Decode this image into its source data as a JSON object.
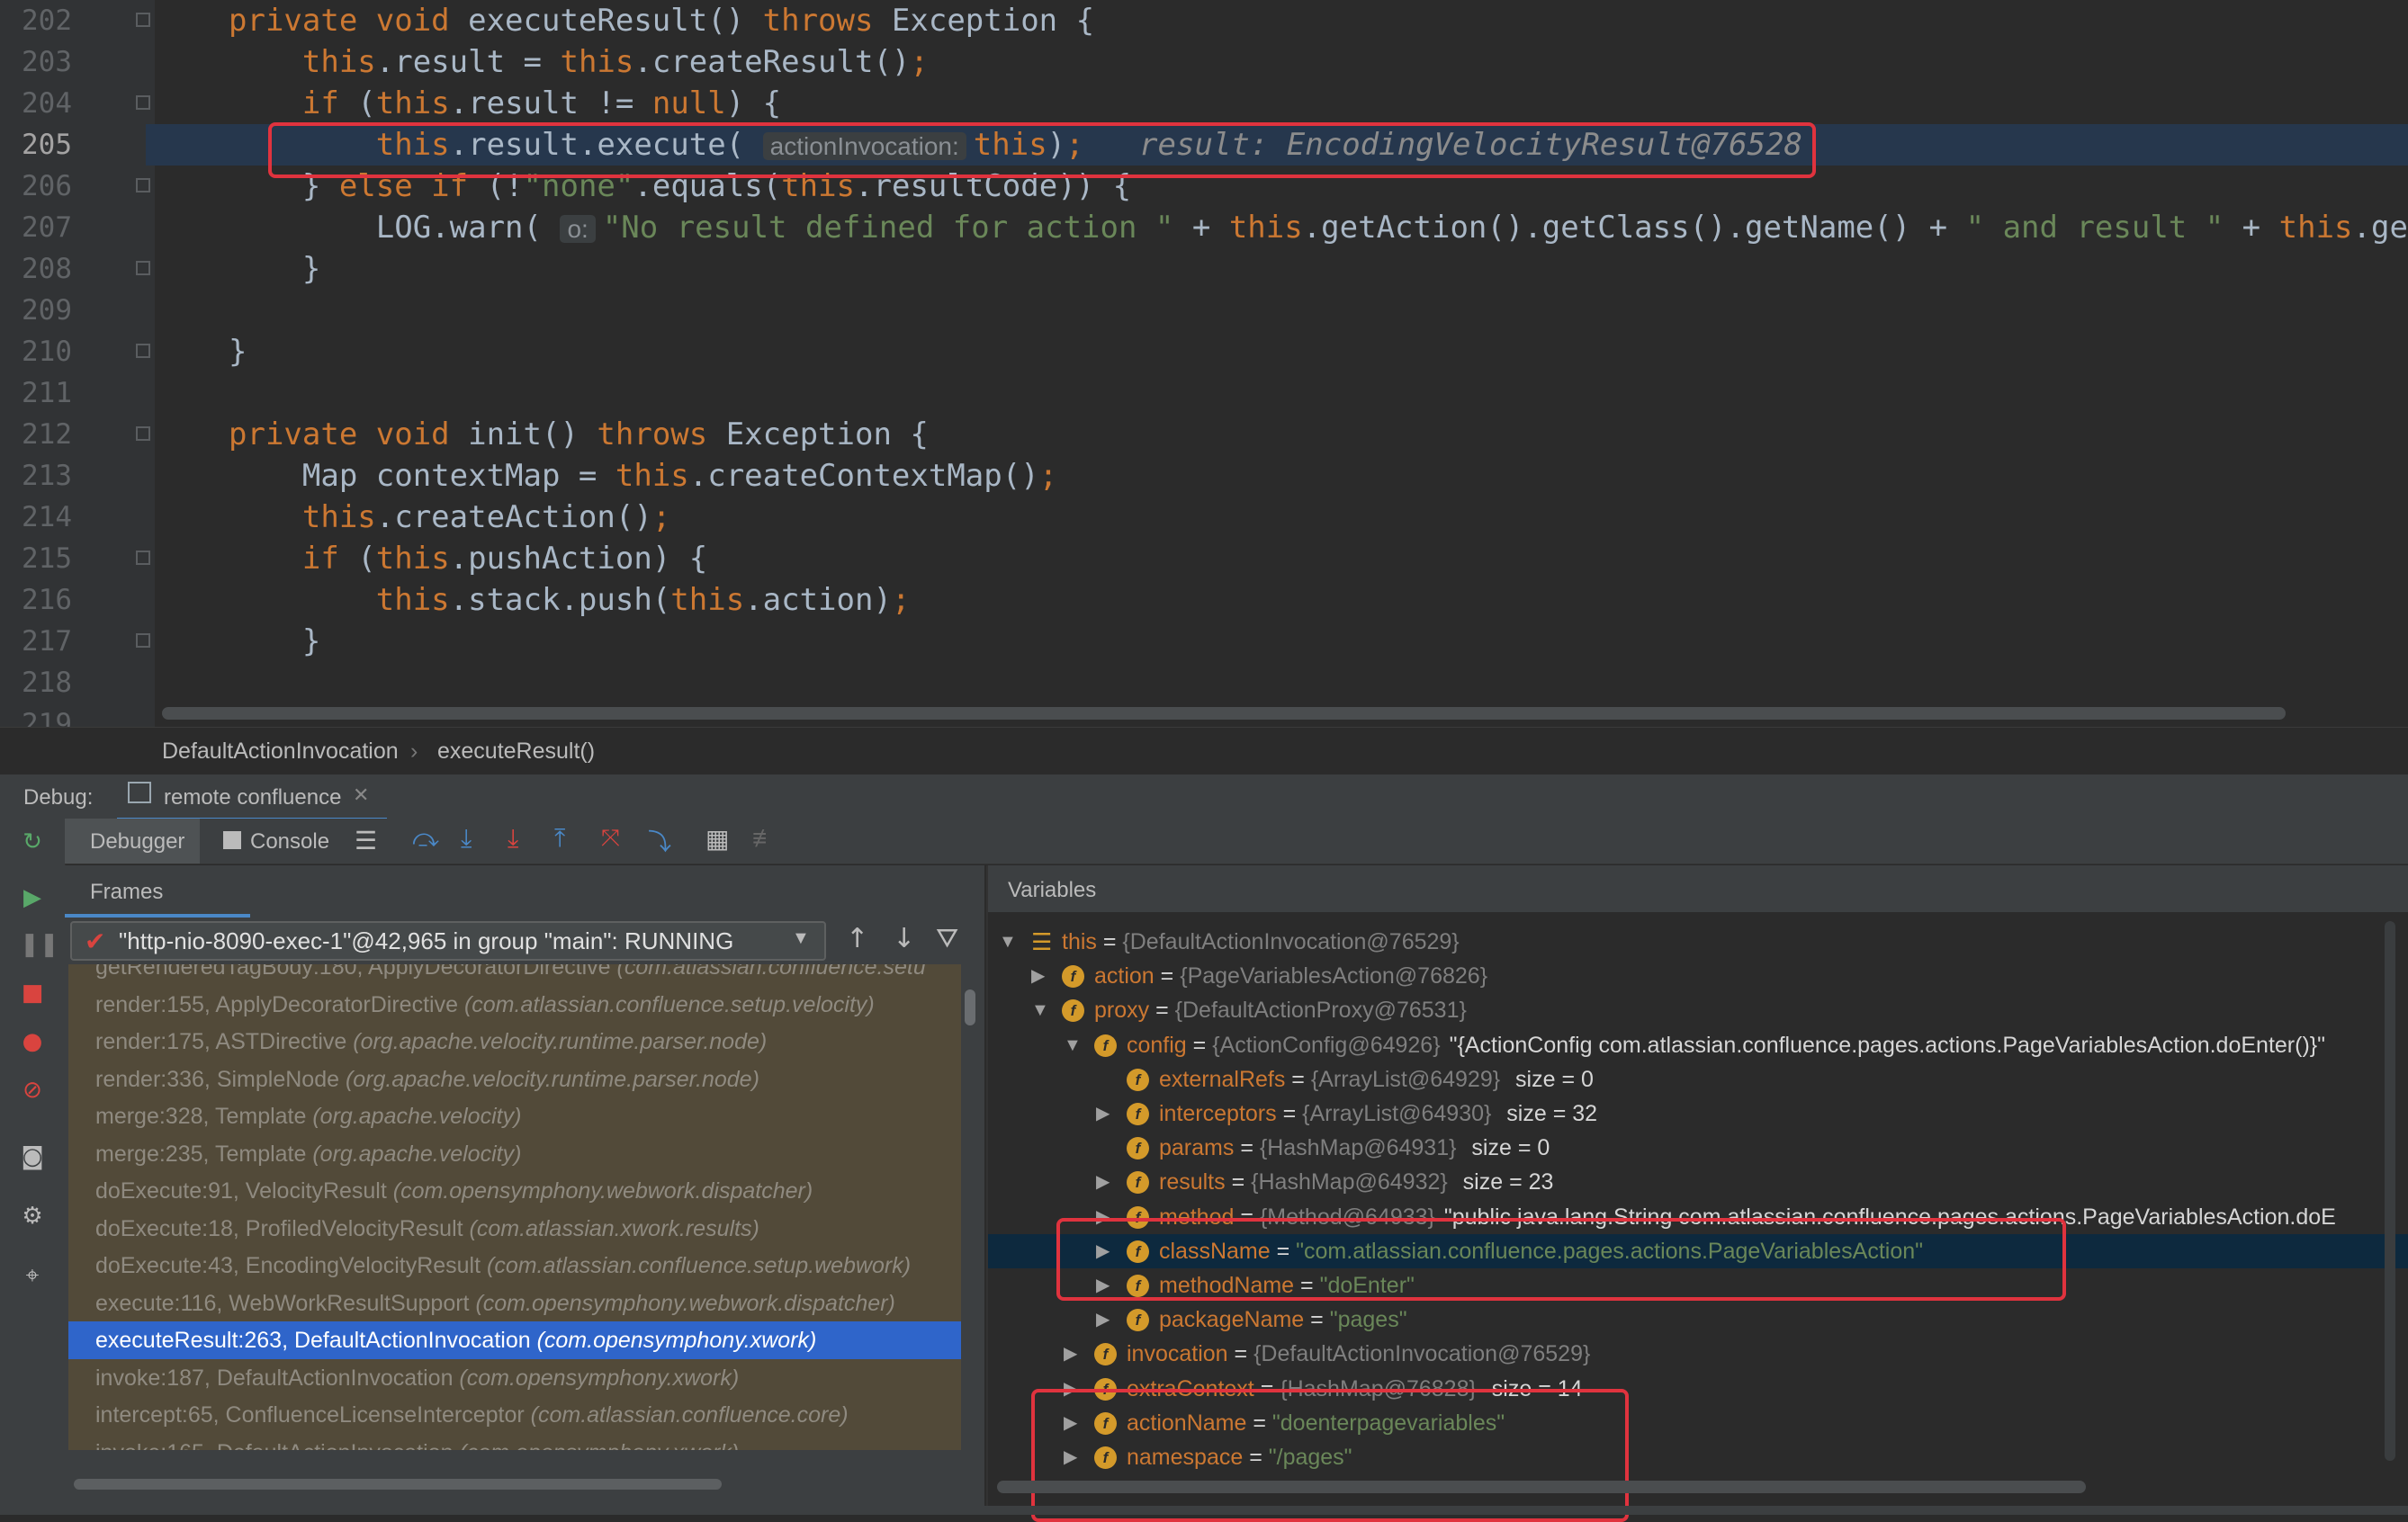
{
  "editor": {
    "lines": [
      {
        "num": "202",
        "tokens": [
          [
            "kw",
            "private void "
          ],
          [
            "",
            "executeResult() "
          ],
          [
            "kw",
            "throws "
          ],
          [
            "",
            "Exception {"
          ]
        ]
      },
      {
        "num": "203",
        "tokens": [
          [
            "kw",
            "    this"
          ],
          [
            "",
            ".result = "
          ],
          [
            "kw",
            "this"
          ],
          [
            "",
            ".createResult()"
          ],
          [
            "kw",
            ";"
          ]
        ]
      },
      {
        "num": "204",
        "tokens": [
          [
            "kw",
            "    if "
          ],
          [
            "",
            "("
          ],
          [
            "kw",
            "this"
          ],
          [
            "",
            ".result != "
          ],
          [
            "kw",
            "null"
          ],
          [
            "",
            ") {"
          ]
        ]
      },
      {
        "num": "205",
        "current": true,
        "tokens": [
          [
            "kw",
            "        this"
          ],
          [
            "",
            ".result.execute( "
          ],
          [
            "hint",
            "actionInvocation:"
          ],
          [
            "kw",
            "this"
          ],
          [
            "",
            ")"
          ],
          [
            "kw",
            ";   "
          ],
          [
            "val",
            "result: EncodingVelocityResult@76528"
          ]
        ]
      },
      {
        "num": "206",
        "tokens": [
          [
            "",
            "    } "
          ],
          [
            "kw",
            "else if "
          ],
          [
            "",
            "(!"
          ],
          [
            "str",
            "\"none\""
          ],
          [
            "",
            ".equals("
          ],
          [
            "kw",
            "this"
          ],
          [
            "",
            ".resultCode)) {"
          ]
        ]
      },
      {
        "num": "207",
        "tokens": [
          [
            "",
            "        LOG.warn( "
          ],
          [
            "hint",
            "o:"
          ],
          [
            "str",
            "\"No result defined for action \""
          ],
          [
            "",
            " + "
          ],
          [
            "kw",
            "this"
          ],
          [
            "",
            ".getAction().getClass().getName() + "
          ],
          [
            "str",
            "\" and result \""
          ],
          [
            "",
            " + "
          ],
          [
            "kw",
            "this"
          ],
          [
            "",
            ".getRes"
          ]
        ]
      },
      {
        "num": "208",
        "tokens": [
          [
            "",
            "    }"
          ]
        ]
      },
      {
        "num": "209",
        "tokens": []
      },
      {
        "num": "210",
        "tokens": [
          [
            "",
            "}"
          ]
        ]
      },
      {
        "num": "211",
        "tokens": []
      },
      {
        "num": "212",
        "tokens": [
          [
            "kw",
            "private void "
          ],
          [
            "",
            "init() "
          ],
          [
            "kw",
            "throws "
          ],
          [
            "",
            "Exception {"
          ]
        ]
      },
      {
        "num": "213",
        "tokens": [
          [
            "",
            "    Map contextMap = "
          ],
          [
            "kw",
            "this"
          ],
          [
            "",
            ".createContextMap()"
          ],
          [
            "kw",
            ";"
          ]
        ]
      },
      {
        "num": "214",
        "tokens": [
          [
            "kw",
            "    this"
          ],
          [
            "",
            ".createAction()"
          ],
          [
            "kw",
            ";"
          ]
        ]
      },
      {
        "num": "215",
        "tokens": [
          [
            "kw",
            "    if "
          ],
          [
            "",
            "("
          ],
          [
            "kw",
            "this"
          ],
          [
            "",
            ".pushAction) {"
          ]
        ]
      },
      {
        "num": "216",
        "tokens": [
          [
            "kw",
            "        this"
          ],
          [
            "",
            ".stack.push("
          ],
          [
            "kw",
            "this"
          ],
          [
            "",
            ".action)"
          ],
          [
            "kw",
            ";"
          ]
        ]
      },
      {
        "num": "217",
        "tokens": [
          [
            "",
            "    }"
          ]
        ]
      },
      {
        "num": "218",
        "tokens": []
      },
      {
        "num": "219",
        "tokens": []
      }
    ]
  },
  "breadcrumb": {
    "class": "DefaultActionInvocation",
    "separator": "›",
    "method": "executeResult()"
  },
  "debug": {
    "label": "Debug:",
    "session": "remote confluence",
    "tabs": {
      "debugger": "Debugger",
      "console": "Console"
    },
    "frames_tab": "Frames",
    "variables_tab": "Variables",
    "thread": "\"http-nio-8090-exec-1\"@42,965 in group \"main\": RUNNING"
  },
  "frames": [
    {
      "loc": "getRenderedTagBody:180, ApplyDecoratorDirective ",
      "pkg": "(com.atlassian.confluence.setu"
    },
    {
      "loc": "render:155, ApplyDecoratorDirective ",
      "pkg": "(com.atlassian.confluence.setup.velocity)"
    },
    {
      "loc": "render:175, ASTDirective ",
      "pkg": "(org.apache.velocity.runtime.parser.node)"
    },
    {
      "loc": "render:336, SimpleNode ",
      "pkg": "(org.apache.velocity.runtime.parser.node)"
    },
    {
      "loc": "merge:328, Template ",
      "pkg": "(org.apache.velocity)"
    },
    {
      "loc": "merge:235, Template ",
      "pkg": "(org.apache.velocity)"
    },
    {
      "loc": "doExecute:91, VelocityResult ",
      "pkg": "(com.opensymphony.webwork.dispatcher)"
    },
    {
      "loc": "doExecute:18, ProfiledVelocityResult ",
      "pkg": "(com.atlassian.xwork.results)"
    },
    {
      "loc": "doExecute:43, EncodingVelocityResult ",
      "pkg": "(com.atlassian.confluence.setup.webwork)"
    },
    {
      "loc": "execute:116, WebWorkResultSupport ",
      "pkg": "(com.opensymphony.webwork.dispatcher)"
    },
    {
      "loc": "executeResult:263, DefaultActionInvocation ",
      "pkg": "(com.opensymphony.xwork)",
      "selected": true
    },
    {
      "loc": "invoke:187, DefaultActionInvocation ",
      "pkg": "(com.opensymphony.xwork)"
    },
    {
      "loc": "intercept:65, ConfluenceLicenseInterceptor ",
      "pkg": "(com.atlassian.confluence.core)"
    },
    {
      "loc": "invoke:165, DefaultActionInvocation ",
      "pkg": "(com.opensymphony.xwork)"
    }
  ],
  "variables": [
    {
      "depth": 0,
      "tri": "down",
      "icon": "list",
      "name": "this",
      "type": "{DefaultActionInvocation@76529}",
      "extra": ""
    },
    {
      "depth": 1,
      "tri": "right",
      "icon": "f",
      "name": "action",
      "type": "{PageVariablesAction@76826}",
      "extra": ""
    },
    {
      "depth": 1,
      "tri": "down",
      "icon": "f",
      "name": "proxy",
      "type": "{DefaultActionProxy@76531}",
      "extra": ""
    },
    {
      "depth": 2,
      "tri": "down",
      "icon": "f",
      "name": "config",
      "type": "{ActionConfig@64926}",
      "extra": "\"{ActionConfig com.atlassian.confluence.pages.actions.PageVariablesAction.doEnter()}\""
    },
    {
      "depth": 3,
      "tri": "",
      "icon": "f",
      "name": "externalRefs",
      "type": "{ArrayList@64929}",
      "extra": " size = 0"
    },
    {
      "depth": 3,
      "tri": "right",
      "icon": "f",
      "name": "interceptors",
      "type": "{ArrayList@64930}",
      "extra": " size = 32"
    },
    {
      "depth": 3,
      "tri": "",
      "icon": "f",
      "name": "params",
      "type": "{HashMap@64931}",
      "extra": " size = 0"
    },
    {
      "depth": 3,
      "tri": "right",
      "icon": "f",
      "name": "results",
      "type": "{HashMap@64932}",
      "extra": " size = 23"
    },
    {
      "depth": 3,
      "tri": "right",
      "icon": "f",
      "name": "method",
      "type": "{Method@64933}",
      "extra": "\"public java.lang.String com.atlassian.confluence.pages.actions.PageVariablesAction.doE"
    },
    {
      "depth": 3,
      "tri": "right",
      "icon": "f",
      "name": "className",
      "str": "\"com.atlassian.confluence.pages.actions.PageVariablesAction\"",
      "selected": true
    },
    {
      "depth": 3,
      "tri": "right",
      "icon": "f",
      "name": "methodName",
      "str": "\"doEnter\""
    },
    {
      "depth": 3,
      "tri": "right",
      "icon": "f",
      "name": "packageName",
      "str": "\"pages\""
    },
    {
      "depth": 2,
      "tri": "right",
      "icon": "f",
      "name": "invocation",
      "type": "{DefaultActionInvocation@76529}",
      "extra": ""
    },
    {
      "depth": 2,
      "tri": "right",
      "icon": "f",
      "name": "extraContext",
      "type": "{HashMap@76828}",
      "extra": " size = 14"
    },
    {
      "depth": 2,
      "tri": "right",
      "icon": "f",
      "name": "actionName",
      "str": "\"doenterpagevariables\""
    },
    {
      "depth": 2,
      "tri": "right",
      "icon": "f",
      "name": "namespace",
      "str": "\"/pages\""
    }
  ],
  "icons": {
    "rerun": "rerun-icon",
    "resume": "resume-icon",
    "pause": "pause-icon",
    "stop": "stop-icon",
    "breakpoints": "view-breakpoints-icon",
    "mute": "mute-breakpoints-icon",
    "snapshot": "camera-icon",
    "settings": "gear-icon",
    "pin": "pin-icon"
  },
  "colors": {
    "keyword": "#cc7832",
    "string": "#6a8759",
    "selection": "#2f65ca",
    "highlight_box": "#e0333e",
    "field_icon": "#d49a2a"
  }
}
